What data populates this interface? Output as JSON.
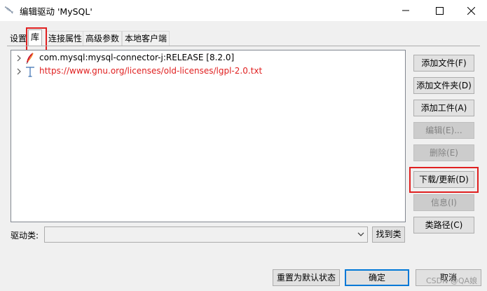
{
  "window": {
    "title": "编辑驱动 'MySQL'",
    "controls": {
      "minimize": "—",
      "maximize": "☐",
      "close": "✕"
    }
  },
  "tabs": [
    {
      "label": "设置",
      "active": false
    },
    {
      "label": "库",
      "active": true
    },
    {
      "label": "连接属性",
      "active": false
    },
    {
      "label": "高级参数",
      "active": false
    },
    {
      "label": "本地客户端",
      "active": false
    }
  ],
  "libraries": [
    {
      "text": "com.mysql:mysql-connector-j:RELEASE [8.2.0]",
      "icon": "maven-feather-icon",
      "is_link": false
    },
    {
      "text": "https://www.gnu.org/licenses/old-licenses/lgpl-2.0.txt",
      "icon": "text-document-icon",
      "is_link": true
    }
  ],
  "side_buttons": [
    {
      "label": "添加文件(F)",
      "enabled": true
    },
    {
      "label": "添加文件夹(D)",
      "enabled": true
    },
    {
      "label": "添加工件(A)",
      "enabled": true
    },
    {
      "label": "编辑(E)...",
      "enabled": false
    },
    {
      "label": "删除(E)",
      "enabled": false
    },
    {
      "label": "下载/更新(D)",
      "enabled": true,
      "highlighted": true
    },
    {
      "label": "信息(I)",
      "enabled": false
    },
    {
      "label": "类路径(C)",
      "enabled": true
    }
  ],
  "driver_class": {
    "label": "驱动类:",
    "value": "",
    "find_label": "找到类"
  },
  "footer": {
    "reset_label": "重置为默认状态",
    "ok_label": "确定",
    "cancel_label": "取消"
  },
  "watermark": "CSDN @QA娘",
  "colors": {
    "highlight": "#e02020",
    "primary_border": "#0078d7",
    "link": "#e02020",
    "window_bg": "#f0f0f0"
  }
}
